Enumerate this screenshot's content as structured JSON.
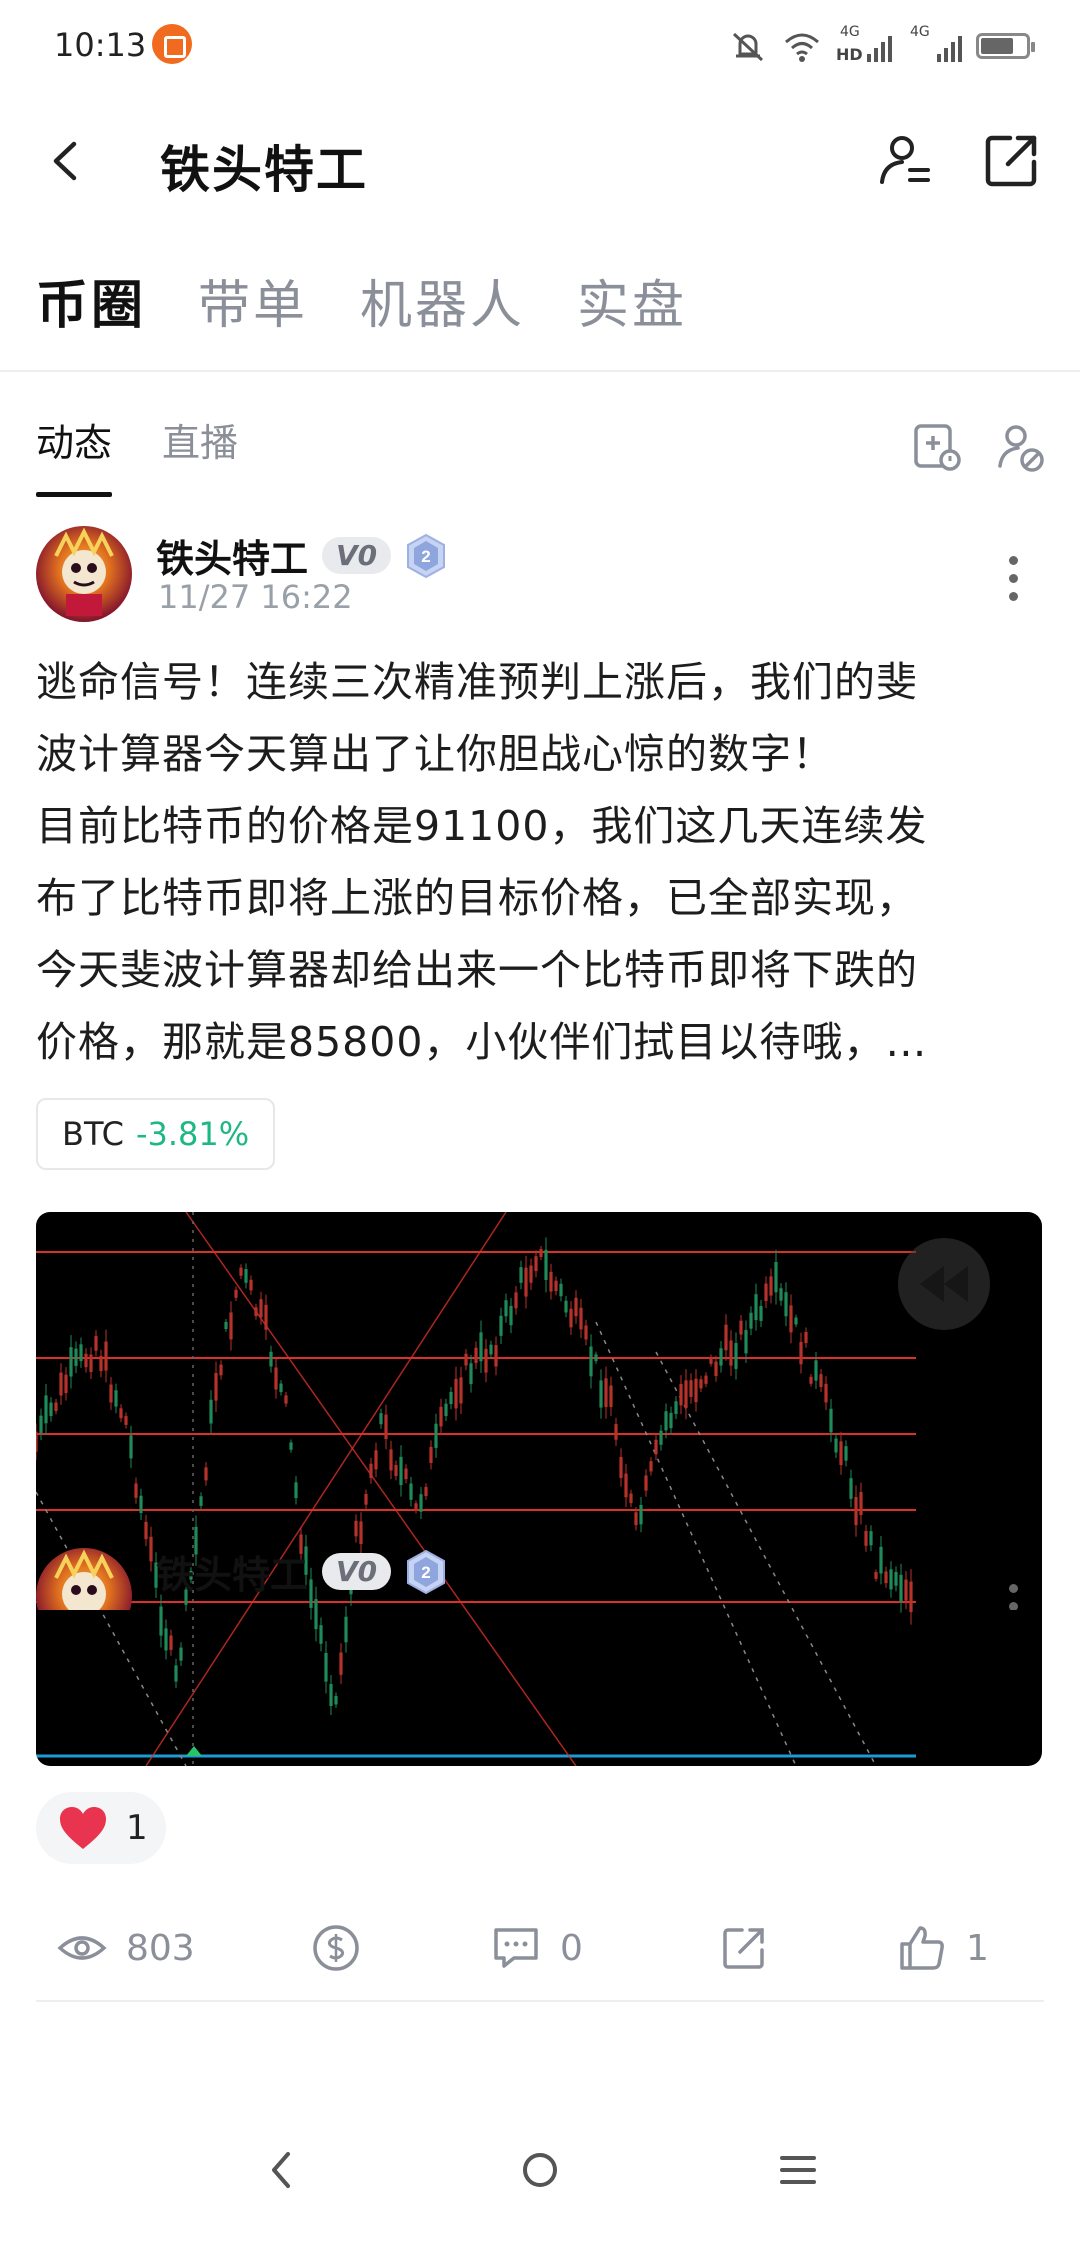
{
  "status_bar": {
    "time": "10:13",
    "signal_1_tag": "4G",
    "signal_2_tag": "4G",
    "hd_label": "HD"
  },
  "header": {
    "title": "铁头特工",
    "back_icon": "chevron-left-icon",
    "profile_icon": "user-settings-icon",
    "share_icon": "share-external-icon"
  },
  "main_tabs": [
    {
      "label": "币圈",
      "active": true
    },
    {
      "label": "带单",
      "active": false
    },
    {
      "label": "机器人",
      "active": false
    },
    {
      "label": "实盘",
      "active": false
    }
  ],
  "sub_tabs": [
    {
      "label": "动态",
      "active": true
    },
    {
      "label": "直播",
      "active": false
    }
  ],
  "post": {
    "author": "铁头特工",
    "vip_label": "V0",
    "level": "2",
    "time": "11/27 16:22",
    "text_lines": [
      "逃命信号！连续三次精准预判上涨后，我们的斐",
      "波计算器今天算出了让你胆战心惊的数字！",
      "目前比特币的价格是91100，我们这几天连续发",
      "布了比特币即将上涨的目标价格，已全部实现，",
      "今天斐波计算器却给出来一个比特币即将下跌的",
      "价格，那就是85800，小伙伴们拭目以待哦，…"
    ],
    "ticker": {
      "symbol": "BTC",
      "change": "-3.81%"
    },
    "reaction": {
      "emoji": "heart",
      "count": "1"
    },
    "stats": {
      "views": "803",
      "comments": "0",
      "likes": "1"
    }
  },
  "post2": {
    "author": "铁头特工",
    "vip_label": "V0",
    "level": "2"
  },
  "colors": {
    "accent_green": "#1fb784",
    "chart_red": "#d9302a",
    "chart_blue": "#1e9bd6"
  }
}
